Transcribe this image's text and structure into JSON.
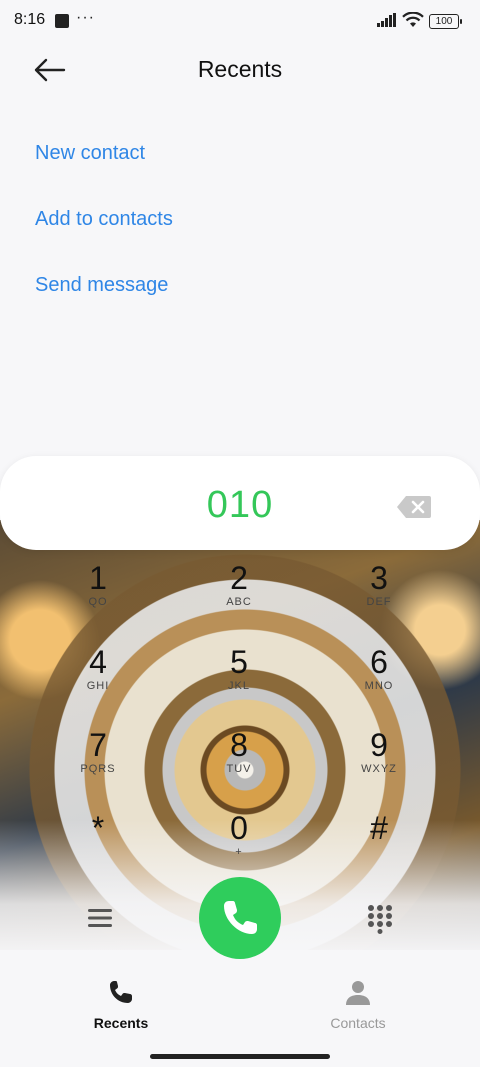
{
  "status_bar": {
    "time": "8:16",
    "more": "···",
    "battery": "100"
  },
  "header": {
    "title": "Recents"
  },
  "actions": [
    {
      "label": "New contact"
    },
    {
      "label": "Add to contacts"
    },
    {
      "label": "Send message"
    }
  ],
  "dialer": {
    "number": "010",
    "keys": [
      {
        "digit": "1",
        "letters": "QO"
      },
      {
        "digit": "2",
        "letters": "ABC"
      },
      {
        "digit": "3",
        "letters": "DEF"
      },
      {
        "digit": "4",
        "letters": "GHI"
      },
      {
        "digit": "5",
        "letters": "JKL"
      },
      {
        "digit": "6",
        "letters": "MNO"
      },
      {
        "digit": "7",
        "letters": "PQRS"
      },
      {
        "digit": "8",
        "letters": "TUV"
      },
      {
        "digit": "9",
        "letters": "WXYZ"
      },
      {
        "digit": "*",
        "letters": ""
      },
      {
        "digit": "0",
        "letters": "+"
      },
      {
        "digit": "#",
        "letters": ""
      }
    ]
  },
  "bottom_nav": {
    "recents": "Recents",
    "contacts": "Contacts"
  },
  "colors": {
    "accent_link": "#2f86e6",
    "call_green": "#2fcd5c",
    "number_green": "#34c759"
  }
}
